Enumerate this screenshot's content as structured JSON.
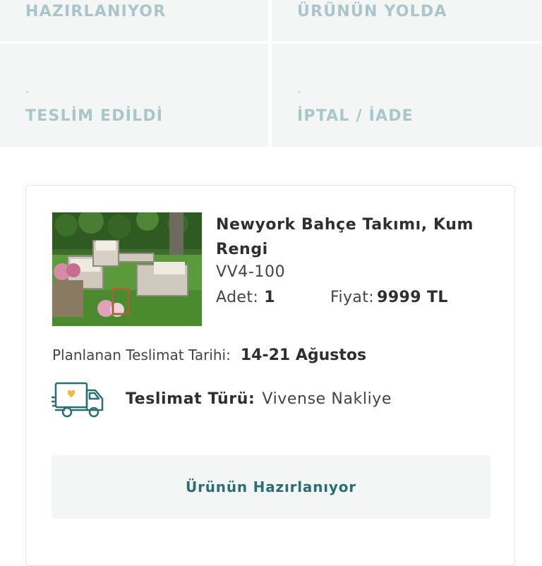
{
  "order_status": {
    "steps": [
      {
        "label": "HAZIRLANIYOR",
        "value": ""
      },
      {
        "label": "ÜRÜNÜN YOLDA",
        "value": ""
      },
      {
        "label": "TESLİM EDİLDİ",
        "value": "-"
      },
      {
        "label": "İPTAL / İADE",
        "value": "-"
      }
    ],
    "label_color": "#a9c6ca"
  },
  "order_item": {
    "name": "Newyork Bahçe Takımı, Kum Rengi",
    "sku": "VV4-100",
    "quantity_label": "Adet:",
    "quantity": "1",
    "price_label": "Fiyat:",
    "price": "9999 TL",
    "image_icon": "product-photo-garden-furniture"
  },
  "delivery": {
    "planned_label": "Planlanan Teslimat Tarihi:",
    "planned_date": "14-21 Ağustos",
    "type_label": "Teslimat Türü:",
    "type_value": "Vivense Nakliye",
    "icon": "delivery-truck-icon",
    "icon_color": "#2a6f74",
    "heart_color": "#f3b93b"
  },
  "status_button": {
    "label": "Ürünün Hazırlanıyor",
    "color": "#2a6f74"
  }
}
